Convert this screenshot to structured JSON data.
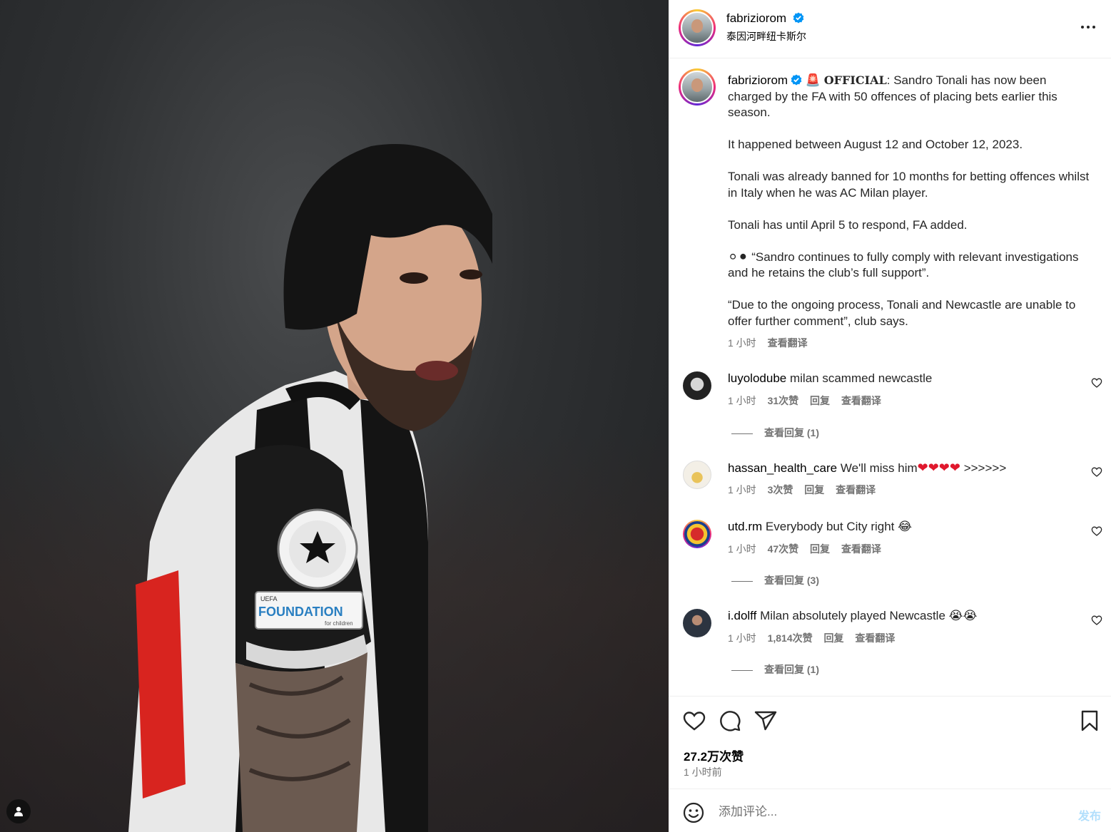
{
  "post": {
    "username": "fabriziorom",
    "location": "泰因河畔纽卡斯尔",
    "caption": {
      "alert_icon": "🚨",
      "official_word": "OFFICIAL",
      "first_line": ": Sandro Tonali has now been charged by the FA with 50 offences of placing bets earlier this season.",
      "paragraphs": [
        "It happened between August 12 and October 12, 2023.",
        "Tonali was already banned for 10 months for betting offences whilst in Italy when he was AC Milan player.",
        "Tonali has until April 5 to respond, FA added.",
        "⚪⚫ “Sandro continues to fully comply with relevant investigations and he retains the club’s full support”.",
        "“Due to the ongoing process, Tonali and Newcastle are unable to offer further comment”, club says."
      ],
      "time": "1 小时",
      "translate": "查看翻译"
    },
    "comments": [
      {
        "username": "luyolodube",
        "text": "milan scammed newcastle",
        "time": "1 小时",
        "likes": "31次赞",
        "reply": "回复",
        "translate": "查看翻译",
        "view_replies": "查看回复 (1)"
      },
      {
        "username": "hassan_health_care",
        "text": "We'll miss him",
        "hearts": "❤❤❤❤",
        "suffix": ">>>>>>",
        "time": "1 小时",
        "likes": "3次赞",
        "reply": "回复",
        "translate": "查看翻译",
        "view_replies": ""
      },
      {
        "username": "utd.rm",
        "text": "Everybody but City right 😂",
        "time": "1 小时",
        "likes": "47次赞",
        "reply": "回复",
        "translate": "查看翻译",
        "view_replies": "查看回复 (3)"
      },
      {
        "username": "i.dolff",
        "text": "Milan absolutely played Newcastle 😭😭",
        "time": "1 小时",
        "likes": "1,814次赞",
        "reply": "回复",
        "translate": "查看翻译",
        "view_replies": "查看回复 (1)"
      }
    ],
    "likes_total": "27.2万次赞",
    "posted": "1 小时前",
    "comment_placeholder": "添加评论...",
    "post_button": "发布"
  },
  "image": {
    "alt": "Sandro Tonali in Newcastle shirt",
    "patch_text_small": "UEFA",
    "patch_text": "FOUNDATION",
    "patch_subtext": "for children"
  },
  "icons": {
    "header_more": "more-options-icon",
    "actions": [
      "heart-icon",
      "comment-icon",
      "share-icon",
      "bookmark-icon"
    ],
    "emoji": "emoji-icon",
    "user_tag": "user-tag-icon"
  },
  "colors": {
    "verified": "#0095f6",
    "muted": "#737373",
    "post_button_disabled": "#b2dffc",
    "heart": "#e0182d"
  }
}
